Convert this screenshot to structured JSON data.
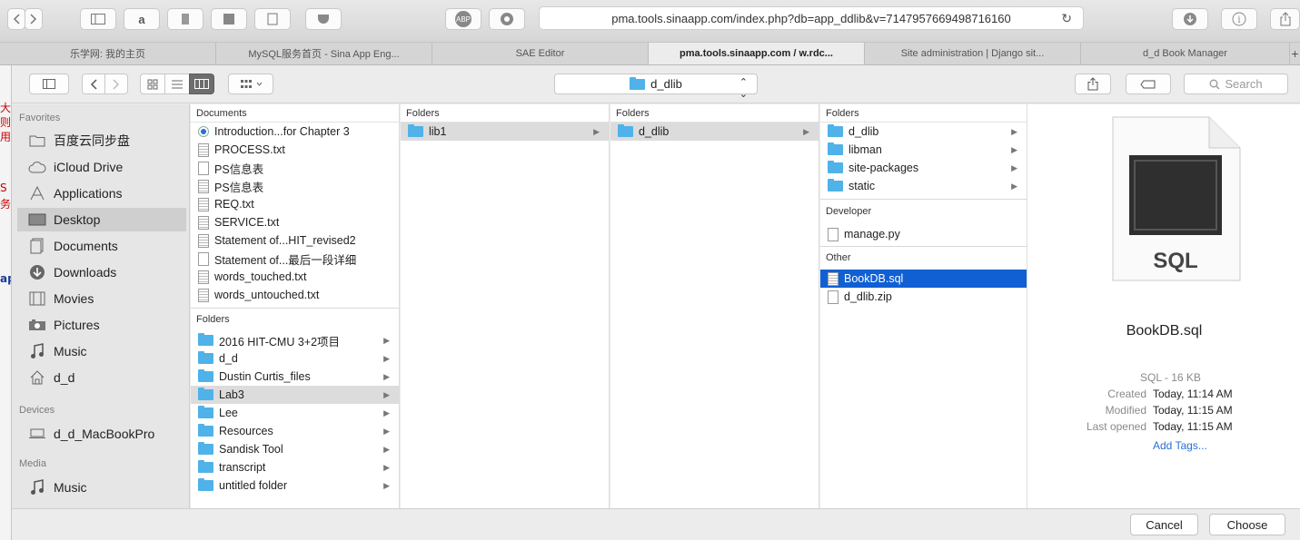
{
  "browser": {
    "address": "pma.tools.sinaapp.com/index.php?db=app_ddlib&v=7147957669498716160",
    "abp_label": "ABP",
    "tabs": [
      {
        "label": "乐学网: 我的主页"
      },
      {
        "label": "MySQL服务首页 - Sina App Eng..."
      },
      {
        "label": "SAE Editor"
      },
      {
        "label": "pma.tools.sinaapp.com / w.rdc..."
      },
      {
        "label": "Site administration | Django sit..."
      },
      {
        "label": "d_d Book Manager"
      }
    ],
    "new_tab": "+",
    "page_left_chars": [
      "大",
      "则",
      "用",
      "S",
      "务",
      "ap"
    ]
  },
  "dialog": {
    "path": "d_dlib",
    "search_placeholder": "Search",
    "sidebar": {
      "favorites_head": "Favorites",
      "favorites": [
        {
          "label": "百度云同步盘",
          "icon": "folder-icon"
        },
        {
          "label": "iCloud Drive",
          "icon": "cloud-icon"
        },
        {
          "label": "Applications",
          "icon": "applications-icon"
        },
        {
          "label": "Desktop",
          "icon": "desktop-icon"
        },
        {
          "label": "Documents",
          "icon": "documents-icon"
        },
        {
          "label": "Downloads",
          "icon": "downloads-icon"
        },
        {
          "label": "Movies",
          "icon": "movies-icon"
        },
        {
          "label": "Pictures",
          "icon": "pictures-icon"
        },
        {
          "label": "Music",
          "icon": "music-icon"
        },
        {
          "label": "d_d",
          "icon": "home-icon"
        }
      ],
      "devices_head": "Devices",
      "devices": [
        {
          "label": "d_d_MacBookPro",
          "icon": "laptop-icon"
        }
      ],
      "media_head": "Media",
      "media": [
        {
          "label": "Music",
          "icon": "music-icon"
        }
      ]
    },
    "col1": {
      "documents_head": "Documents",
      "documents": [
        "Introduction...for Chapter 3",
        "PROCESS.txt",
        "PS信息表",
        "PS信息表",
        "REQ.txt",
        "SERVICE.txt",
        "Statement of...HIT_revised2",
        "Statement of...最后一段详细",
        "words_touched.txt",
        "words_untouched.txt"
      ],
      "folders_head": "Folders",
      "folders": [
        "2016 HIT-CMU 3+2项目",
        "d_d",
        "Dustin Curtis_files",
        "Lab3",
        "Lee",
        "Resources",
        "Sandisk Tool",
        "transcript",
        "untitled folder"
      ]
    },
    "col2": {
      "head": "Folders",
      "items": [
        "lib1"
      ]
    },
    "col3": {
      "head": "Folders",
      "items": [
        "d_dlib"
      ]
    },
    "col4": {
      "head": "Folders",
      "folders": [
        "d_dlib",
        "libman",
        "site-packages",
        "static"
      ],
      "developer_head": "Developer",
      "developer": [
        "manage.py"
      ],
      "other_head": "Other",
      "other": [
        "BookDB.sql",
        "d_dlib.zip"
      ]
    },
    "preview": {
      "icon_text": "SQL",
      "name": "BookDB.sql",
      "kind": "SQL - 16 KB",
      "created_label": "Created",
      "created": "Today, 11:14 AM",
      "modified_label": "Modified",
      "modified": "Today, 11:15 AM",
      "opened_label": "Last opened",
      "opened": "Today, 11:15 AM",
      "add_tags": "Add Tags..."
    },
    "cancel": "Cancel",
    "choose": "Choose"
  }
}
